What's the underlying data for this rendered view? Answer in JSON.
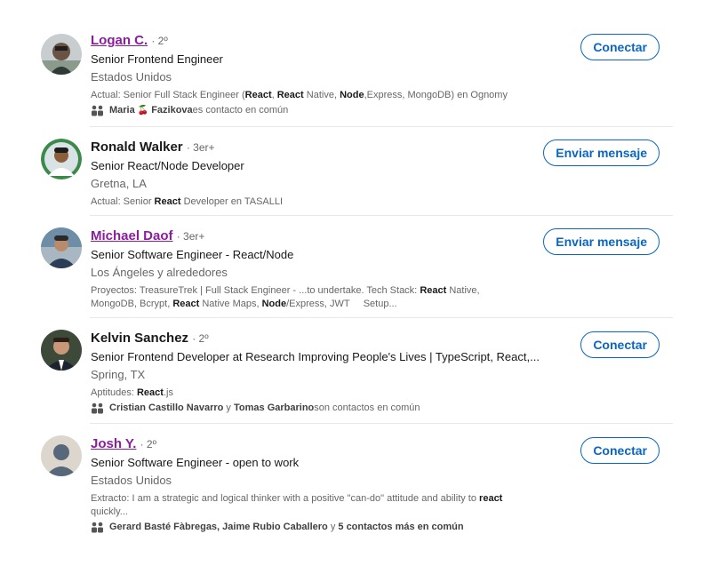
{
  "results": [
    {
      "name": "Logan C.",
      "degree": "· 2º",
      "headline": "Senior Frontend Engineer",
      "location": "Estados Unidos",
      "summary_parts": [
        "Actual: Senior Full Stack Engineer (",
        "React",
        ", ",
        "React",
        " Native, ",
        "Node",
        ",Express, MongoDB) en Ognomy"
      ],
      "connections": {
        "p1": "Maria",
        "emoji": "🍒",
        "p2": "Fazikova",
        "suffix": " es contacto en común"
      },
      "action": "Conectar"
    },
    {
      "name": "Ronald Walker",
      "degree": "· 3er+",
      "headline": "Senior React/Node Developer",
      "location": "Gretna, LA",
      "summary_parts": [
        "Actual: Senior ",
        "React",
        " Developer en TASALLI"
      ],
      "action": "Enviar mensaje"
    },
    {
      "name": "Michael Daof",
      "degree": "· 3er+",
      "headline": "Senior Software Engineer - React/Node",
      "location": "Los Ángeles y alrededores",
      "summary_parts": [
        "Proyectos: TreasureTrek | Full Stack Engineer - ...to undertake. Tech Stack: ",
        "React",
        " Native,",
        "MongoDB, Bcrypt, ",
        "React",
        " Native Maps, ",
        "Node",
        "/Express, JWT     Setup..."
      ],
      "action": "Enviar mensaje"
    },
    {
      "name": "Kelvin Sanchez",
      "degree": "· 2º",
      "headline": "Senior Frontend Developer at Research Improving People's Lives | TypeScript, React,...",
      "location": "Spring, TX",
      "summary_parts": [
        "Aptitudes: ",
        "React",
        ".js"
      ],
      "connections": {
        "p1": "Cristian Castillo Navarro",
        "mid": " y ",
        "p2": "Tomas Garbarino",
        "suffix": " son contactos en común"
      },
      "action": "Conectar"
    },
    {
      "name": "Josh Y.",
      "degree": "· 2º",
      "headline": "Senior Software Engineer - open to work",
      "location": "Estados Unidos",
      "summary_parts": [
        "Extracto: I am a strategic and logical thinker with a positive \"can-do\" attitude and ability to ",
        "react",
        " quickly..."
      ],
      "connections": {
        "p1": "Gerard Basté Fàbregas, Jaime Rubio Caballero",
        "mid": " y ",
        "p2": "5 contactos más en común"
      },
      "action": "Conectar"
    }
  ],
  "colors": {
    "link_visited": "#8a1e9b",
    "brand_blue": "#0a66c2",
    "muted": "#666666"
  }
}
